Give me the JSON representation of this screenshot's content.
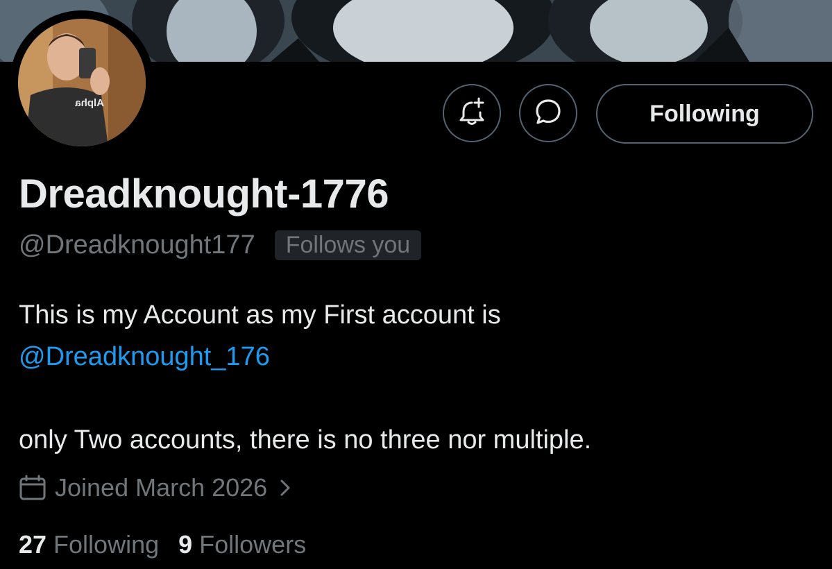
{
  "profile": {
    "display_name": "Dreadknought-1776",
    "handle": "@Dreadknought177",
    "follows_you": "Follows you",
    "bio": {
      "line1": "This is my Account as my First account is",
      "mention": "@Dreadknought_176",
      "line3": "only Two accounts, there is no three nor multiple."
    },
    "joined": "Joined March 2026",
    "stats": {
      "following_count": "27",
      "following_label": "Following",
      "followers_count": "9",
      "followers_label": "Followers"
    },
    "avatar_shirt_text": "Alpha"
  },
  "actions": {
    "notify_icon": "bell-plus-icon",
    "message_icon": "message-icon",
    "follow_label": "Following"
  },
  "colors": {
    "background": "#000000",
    "primary_text": "#e7e9ea",
    "secondary_text": "#71767b",
    "link": "#1d9bf0",
    "border": "#536471"
  }
}
